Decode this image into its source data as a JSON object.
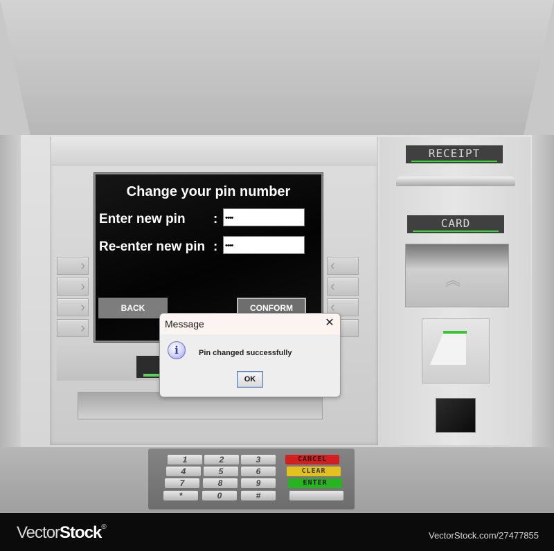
{
  "screen": {
    "title": "Change your pin number",
    "new_pin_label": "Enter new pin",
    "reenter_pin_label": "Re-enter new pin",
    "colon": ":",
    "new_pin_value": "••••",
    "reenter_pin_value": "••••",
    "back_label": "BACK",
    "conform_label": "CONFORM"
  },
  "dialog": {
    "title": "Message",
    "close_glyph": "✕",
    "info_glyph": "i",
    "message": "Pin changed successfully",
    "ok_label": "OK"
  },
  "atm": {
    "receipt_label": "RECEIPT",
    "card_label": "CARD",
    "side_key_glyph_left": "›",
    "side_key_glyph_right": "‹",
    "card_reader_glyph": "︽"
  },
  "keypad": {
    "numbers": [
      "1",
      "2",
      "3",
      "4",
      "5",
      "6",
      "7",
      "8",
      "9",
      "*",
      "0",
      "#"
    ],
    "cancel_label": "CANCEL",
    "clear_label": "CLEAR",
    "enter_label": "ENTER"
  },
  "footer": {
    "brand_vector": "Vector",
    "brand_stock": "Stock",
    "brand_reg": "®",
    "stock_id": "VectorStock.com/27477855"
  },
  "colors": {
    "cancel": "#d21f1f",
    "clear": "#e3c21e",
    "enter": "#27b51f",
    "status_led": "#35d835"
  },
  "icons": [
    "info-icon",
    "close-icon",
    "chevron-right-icon",
    "chevron-left-icon"
  ]
}
